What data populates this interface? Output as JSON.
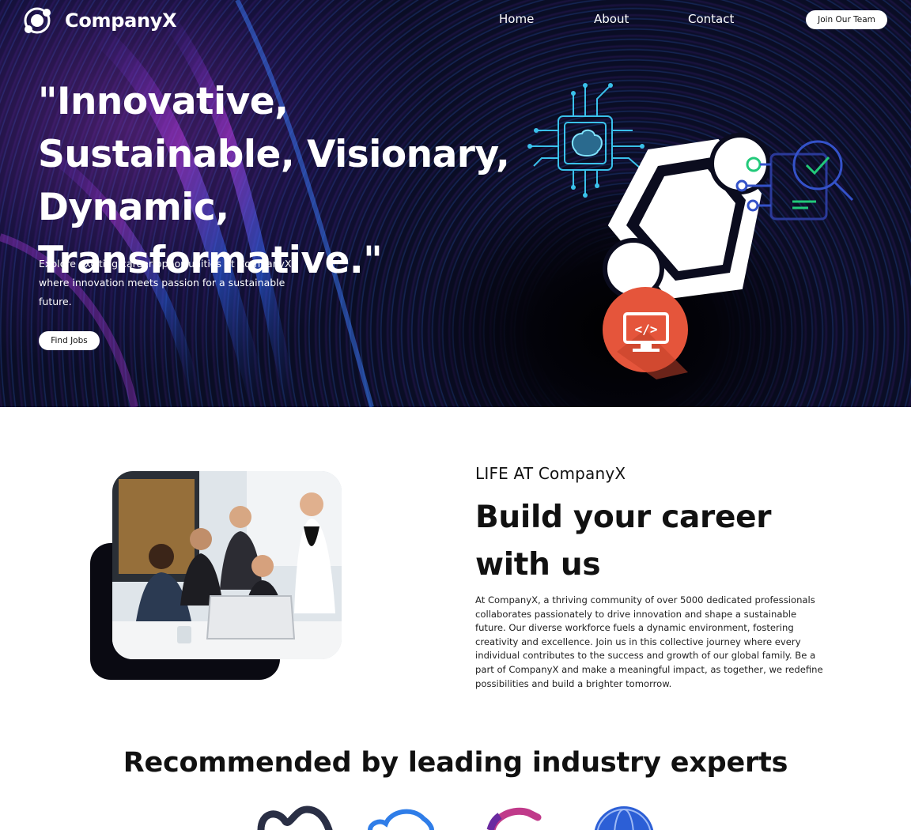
{
  "brand": {
    "name": "CompanyX"
  },
  "nav": {
    "links": [
      "Home",
      "About",
      "Contact"
    ],
    "cta_label": "Join Our Team"
  },
  "hero": {
    "title": "\"Innovative, Sustainable, Visionary, Dynamic, Transformative.\"",
    "subtitle": "Explore exciting career opportunities at CompanyX, where innovation meets passion for a sustainable future.",
    "button_label": "Find Jobs"
  },
  "life": {
    "kicker": "LIFE AT CompanyX",
    "title": "Build your career with us",
    "body": "At CompanyX, a thriving community of over 5000 dedicated professionals collaborates passionately to drive innovation and shape a sustainable future. Our diverse workforce fuels a dynamic environment, fostering creativity and excellence. Join us in this collective journey where every individual contributes to the success and growth of our global family. Be a part of CompanyX and make a meaningful impact, as together, we redefine possibilities and build a brighter tomorrow."
  },
  "recommended": {
    "title": "Recommended by leading industry experts",
    "logos": [
      "meta-logo-icon",
      "cloud-logo-icon",
      "swirl-logo-icon",
      "globe-logo-icon"
    ]
  },
  "colors": {
    "hero_bg": "#080a1e",
    "accent_purple": "#b43ce6",
    "accent_blue": "#2a6cff",
    "code_badge": "#e5553b",
    "text_dark": "#111111"
  }
}
